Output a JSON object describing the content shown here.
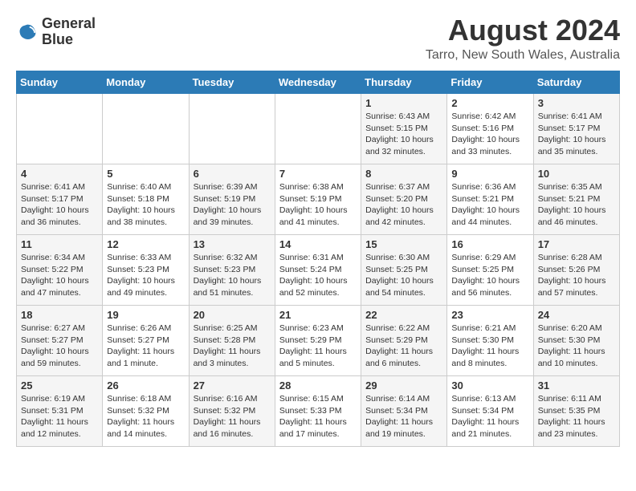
{
  "header": {
    "logo_line1": "General",
    "logo_line2": "Blue",
    "month_year": "August 2024",
    "location": "Tarro, New South Wales, Australia"
  },
  "weekdays": [
    "Sunday",
    "Monday",
    "Tuesday",
    "Wednesday",
    "Thursday",
    "Friday",
    "Saturday"
  ],
  "weeks": [
    [
      {
        "day": "",
        "info": ""
      },
      {
        "day": "",
        "info": ""
      },
      {
        "day": "",
        "info": ""
      },
      {
        "day": "",
        "info": ""
      },
      {
        "day": "1",
        "info": "Sunrise: 6:43 AM\nSunset: 5:15 PM\nDaylight: 10 hours\nand 32 minutes."
      },
      {
        "day": "2",
        "info": "Sunrise: 6:42 AM\nSunset: 5:16 PM\nDaylight: 10 hours\nand 33 minutes."
      },
      {
        "day": "3",
        "info": "Sunrise: 6:41 AM\nSunset: 5:17 PM\nDaylight: 10 hours\nand 35 minutes."
      }
    ],
    [
      {
        "day": "4",
        "info": "Sunrise: 6:41 AM\nSunset: 5:17 PM\nDaylight: 10 hours\nand 36 minutes."
      },
      {
        "day": "5",
        "info": "Sunrise: 6:40 AM\nSunset: 5:18 PM\nDaylight: 10 hours\nand 38 minutes."
      },
      {
        "day": "6",
        "info": "Sunrise: 6:39 AM\nSunset: 5:19 PM\nDaylight: 10 hours\nand 39 minutes."
      },
      {
        "day": "7",
        "info": "Sunrise: 6:38 AM\nSunset: 5:19 PM\nDaylight: 10 hours\nand 41 minutes."
      },
      {
        "day": "8",
        "info": "Sunrise: 6:37 AM\nSunset: 5:20 PM\nDaylight: 10 hours\nand 42 minutes."
      },
      {
        "day": "9",
        "info": "Sunrise: 6:36 AM\nSunset: 5:21 PM\nDaylight: 10 hours\nand 44 minutes."
      },
      {
        "day": "10",
        "info": "Sunrise: 6:35 AM\nSunset: 5:21 PM\nDaylight: 10 hours\nand 46 minutes."
      }
    ],
    [
      {
        "day": "11",
        "info": "Sunrise: 6:34 AM\nSunset: 5:22 PM\nDaylight: 10 hours\nand 47 minutes."
      },
      {
        "day": "12",
        "info": "Sunrise: 6:33 AM\nSunset: 5:23 PM\nDaylight: 10 hours\nand 49 minutes."
      },
      {
        "day": "13",
        "info": "Sunrise: 6:32 AM\nSunset: 5:23 PM\nDaylight: 10 hours\nand 51 minutes."
      },
      {
        "day": "14",
        "info": "Sunrise: 6:31 AM\nSunset: 5:24 PM\nDaylight: 10 hours\nand 52 minutes."
      },
      {
        "day": "15",
        "info": "Sunrise: 6:30 AM\nSunset: 5:25 PM\nDaylight: 10 hours\nand 54 minutes."
      },
      {
        "day": "16",
        "info": "Sunrise: 6:29 AM\nSunset: 5:25 PM\nDaylight: 10 hours\nand 56 minutes."
      },
      {
        "day": "17",
        "info": "Sunrise: 6:28 AM\nSunset: 5:26 PM\nDaylight: 10 hours\nand 57 minutes."
      }
    ],
    [
      {
        "day": "18",
        "info": "Sunrise: 6:27 AM\nSunset: 5:27 PM\nDaylight: 10 hours\nand 59 minutes."
      },
      {
        "day": "19",
        "info": "Sunrise: 6:26 AM\nSunset: 5:27 PM\nDaylight: 11 hours\nand 1 minute."
      },
      {
        "day": "20",
        "info": "Sunrise: 6:25 AM\nSunset: 5:28 PM\nDaylight: 11 hours\nand 3 minutes."
      },
      {
        "day": "21",
        "info": "Sunrise: 6:23 AM\nSunset: 5:29 PM\nDaylight: 11 hours\nand 5 minutes."
      },
      {
        "day": "22",
        "info": "Sunrise: 6:22 AM\nSunset: 5:29 PM\nDaylight: 11 hours\nand 6 minutes."
      },
      {
        "day": "23",
        "info": "Sunrise: 6:21 AM\nSunset: 5:30 PM\nDaylight: 11 hours\nand 8 minutes."
      },
      {
        "day": "24",
        "info": "Sunrise: 6:20 AM\nSunset: 5:30 PM\nDaylight: 11 hours\nand 10 minutes."
      }
    ],
    [
      {
        "day": "25",
        "info": "Sunrise: 6:19 AM\nSunset: 5:31 PM\nDaylight: 11 hours\nand 12 minutes."
      },
      {
        "day": "26",
        "info": "Sunrise: 6:18 AM\nSunset: 5:32 PM\nDaylight: 11 hours\nand 14 minutes."
      },
      {
        "day": "27",
        "info": "Sunrise: 6:16 AM\nSunset: 5:32 PM\nDaylight: 11 hours\nand 16 minutes."
      },
      {
        "day": "28",
        "info": "Sunrise: 6:15 AM\nSunset: 5:33 PM\nDaylight: 11 hours\nand 17 minutes."
      },
      {
        "day": "29",
        "info": "Sunrise: 6:14 AM\nSunset: 5:34 PM\nDaylight: 11 hours\nand 19 minutes."
      },
      {
        "day": "30",
        "info": "Sunrise: 6:13 AM\nSunset: 5:34 PM\nDaylight: 11 hours\nand 21 minutes."
      },
      {
        "day": "31",
        "info": "Sunrise: 6:11 AM\nSunset: 5:35 PM\nDaylight: 11 hours\nand 23 minutes."
      }
    ]
  ]
}
